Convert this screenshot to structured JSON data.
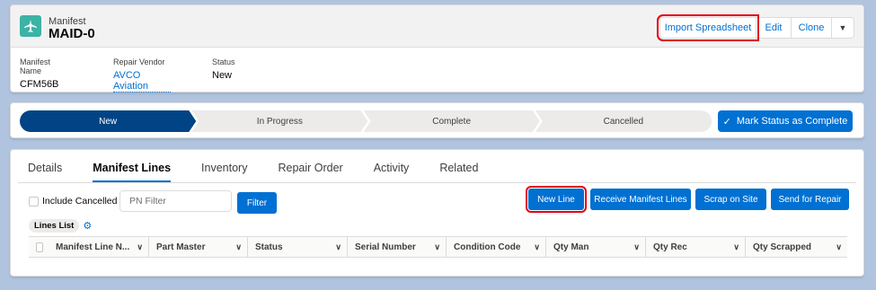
{
  "header": {
    "object_type": "Manifest",
    "record_name": "MAID-0",
    "icon": "airplane-icon",
    "actions": {
      "import_label": "Import Spreadsheet",
      "edit_label": "Edit",
      "clone_label": "Clone",
      "more_icon": "chevron-down-icon"
    },
    "fields": [
      {
        "label": "Manifest Name",
        "value": "CFM56B"
      },
      {
        "label": "Repair Vendor",
        "value": "AVCO Aviation"
      },
      {
        "label": "Status",
        "value": "New"
      }
    ]
  },
  "path": {
    "stages": [
      "New",
      "In Progress",
      "Complete",
      "Cancelled"
    ],
    "active_stage": "New",
    "mark_button_label": "Mark Status as Complete",
    "mark_icon": "check-icon"
  },
  "tabs": {
    "items": [
      "Details",
      "Manifest Lines",
      "Inventory",
      "Repair Order",
      "Activity",
      "Related"
    ],
    "active": "Manifest Lines"
  },
  "toolbar": {
    "include_cancelled_label": "Include Cancelled",
    "pn_filter_placeholder": "PN Filter",
    "filter_label": "Filter",
    "new_line_label": "New Line",
    "receive_label": "Receive Manifest Lines",
    "scrap_label": "Scrap on Site",
    "send_label": "Send for Repair"
  },
  "list": {
    "title": "Lines List",
    "settings_icon": "gear-icon",
    "columns": [
      "Manifest Line N...",
      "Part Master",
      "Status",
      "Serial Number",
      "Condition Code",
      "Qty Man",
      "Qty Rec",
      "Qty Scrapped"
    ]
  },
  "colors": {
    "brand": "#0070d2",
    "path_active": "#014486",
    "highlight": "#e3000f",
    "icon_bg": "#3bb3a6",
    "page_bg": "#b0c4df"
  }
}
